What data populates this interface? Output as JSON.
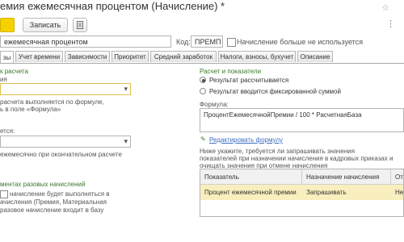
{
  "window": {
    "title": "емия ежемесячная процентом (Начисление) *"
  },
  "toolbar": {
    "record_label": "Записать"
  },
  "header": {
    "name_value": "ежемесячная процентом",
    "code_label": "Код:",
    "code_value": "ПРЕМП",
    "unused_label": "Начисление больше не используется"
  },
  "tabs": [
    {
      "label": "зы"
    },
    {
      "label": "Учет времени"
    },
    {
      "label": "Зависимости"
    },
    {
      "label": "Приоритет"
    },
    {
      "label": "Средний заработок"
    },
    {
      "label": "Налоги, взносы, бухучет"
    },
    {
      "label": "Описание"
    }
  ],
  "left": {
    "section_title": "к расчета",
    "subtitle": "ия",
    "hint1_line1": "расчета выполняется по формуле,",
    "hint1_line2": "ь в поле «Формула»",
    "label2": "ется:",
    "hint2": "ежемесячно при окончательном расчете",
    "section3_title": "ментах разовых начислений",
    "hint3_line1": "начисление будет выполняться в",
    "hint3_line2": "ачисления (Премия, Материальная",
    "hint3_line3": "разовое начисление входит в базу"
  },
  "right": {
    "section_title": "Расчет и показатели",
    "radio_calc": "Результат рассчитывается",
    "radio_fixed": "Результат вводится фиксированной суммой",
    "formula_label": "Формула:",
    "formula_value": "ПроцентЕжемесячнойПремии / 100 * РасчетнаяБаза",
    "edit_formula_link": "Редактировать формулу",
    "note_line1": "Ниже укажите, требуется ли запрашивать значения",
    "note_line2": "показателей при назначении начисления в кадровых приказах и",
    "note_line3": "очищать значения при отмене начисления"
  },
  "grid": {
    "columns": [
      "Показатель",
      "Назначение начисления",
      "От"
    ],
    "rows": [
      {
        "cells": [
          "Процент ежемесячной премии",
          "Запрашивать",
          "Не"
        ]
      }
    ]
  },
  "colors": {
    "accent": "#f5d100",
    "link": "#3c6dbf",
    "section_green": "#3b7a2a",
    "row_highlight": "#f9efbe"
  }
}
